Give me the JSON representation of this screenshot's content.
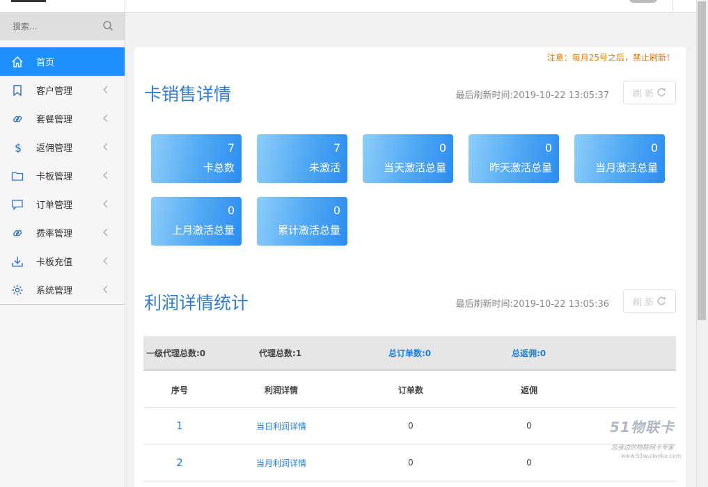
{
  "search": {
    "placeholder": "搜索..."
  },
  "sidebar": {
    "items": [
      {
        "label": "首页",
        "icon": "home-icon",
        "active": true
      },
      {
        "label": "客户管理",
        "icon": "bookmark-icon"
      },
      {
        "label": "套餐管理",
        "icon": "link-icon"
      },
      {
        "label": "返佣管理",
        "icon": "dollar-icon"
      },
      {
        "label": "卡板管理",
        "icon": "folder-icon"
      },
      {
        "label": "订单管理",
        "icon": "chat-icon"
      },
      {
        "label": "费率管理",
        "icon": "link-icon"
      },
      {
        "label": "卡板充值",
        "icon": "download-icon"
      },
      {
        "label": "系统管理",
        "icon": "gear-icon"
      }
    ]
  },
  "notice": "注意：每月25号之后，禁止刷新！",
  "sales": {
    "title": "卡销售详情",
    "refresh_time": "最后刷新时间:2019-10-22 13:05:37",
    "refresh_label": "刷 新",
    "cards": [
      {
        "value": "7",
        "label": "卡总数"
      },
      {
        "value": "7",
        "label": "未激活"
      },
      {
        "value": "0",
        "label": "当天激活总量"
      },
      {
        "value": "0",
        "label": "昨天激活总量"
      },
      {
        "value": "0",
        "label": "当月激活总量"
      },
      {
        "value": "0",
        "label": "上月激活总量"
      },
      {
        "value": "0",
        "label": "累计激活总量"
      }
    ]
  },
  "profit": {
    "title": "利润详情统计",
    "refresh_time": "最后刷新时间:2019-10-22 13:05:36",
    "refresh_label": "刷 新",
    "stats": {
      "level1_agents": "一级代理总数:0",
      "agents": "代理总数:1",
      "orders": "总订单数:0",
      "rebate": "总返佣:0"
    },
    "columns": [
      "序号",
      "利润详情",
      "订单数",
      "返佣"
    ],
    "rows": [
      {
        "idx": "1",
        "name": "当日利润详情",
        "orders": "0",
        "rebate": "0"
      },
      {
        "idx": "2",
        "name": "当月利润详情",
        "orders": "0",
        "rebate": "0"
      }
    ]
  },
  "watermark": {
    "brand": "51物联卡",
    "tagline": "您身边的物联网卡专家",
    "url": "www.51wulianka.com"
  },
  "colors": {
    "accent": "#1e90ff",
    "title": "#2e7dd1",
    "notice": "#e07b00"
  }
}
